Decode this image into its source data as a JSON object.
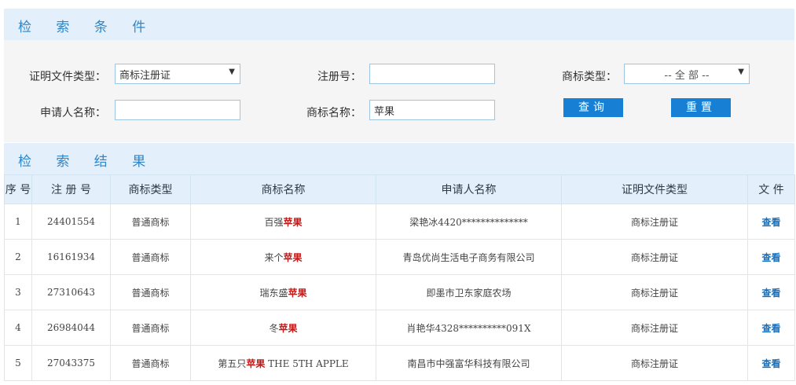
{
  "search": {
    "title": "检 索 条 件",
    "doc_type_label": "证明文件类型：",
    "doc_type_value": "商标注册证",
    "reg_no_label": "注册号：",
    "reg_no_value": "",
    "tm_type_label": "商标类型：",
    "tm_type_value": "-- 全 部 --",
    "applicant_label": "申请人名称：",
    "applicant_value": "",
    "tm_name_label": "商标名称：",
    "tm_name_value": "苹果",
    "query_button": "查询",
    "reset_button": "重置"
  },
  "results": {
    "title": "检 索 结 果",
    "columns": [
      "序 号",
      "注 册 号",
      "商标类型",
      "商标名称",
      "申请人名称",
      "证明文件类型",
      "文 件"
    ],
    "rows": [
      {
        "no": "1",
        "reg": "24401554",
        "type": "普通商标",
        "name_pre": "百强",
        "name_hl": "苹果",
        "name_post": "",
        "applicant": "梁艳冰4420**************",
        "doc": "商标注册证",
        "file": "查看"
      },
      {
        "no": "2",
        "reg": "16161934",
        "type": "普通商标",
        "name_pre": "来个",
        "name_hl": "苹果",
        "name_post": "",
        "applicant": "青岛优尚生活电子商务有限公司",
        "doc": "商标注册证",
        "file": "查看"
      },
      {
        "no": "3",
        "reg": "27310643",
        "type": "普通商标",
        "name_pre": "瑞东盛",
        "name_hl": "苹果",
        "name_post": "",
        "applicant": "即墨市卫东家庭农场",
        "doc": "商标注册证",
        "file": "查看"
      },
      {
        "no": "4",
        "reg": "26984044",
        "type": "普通商标",
        "name_pre": "冬",
        "name_hl": "苹果",
        "name_post": "",
        "applicant": "肖艳华4328**********091X",
        "doc": "商标注册证",
        "file": "查看"
      },
      {
        "no": "5",
        "reg": "27043375",
        "type": "普通商标",
        "name_pre": "第五只",
        "name_hl": "苹果",
        "name_post": " THE 5TH APPLE",
        "applicant": "南昌市中强富华科技有限公司",
        "doc": "商标注册证",
        "file": "查看"
      }
    ]
  }
}
